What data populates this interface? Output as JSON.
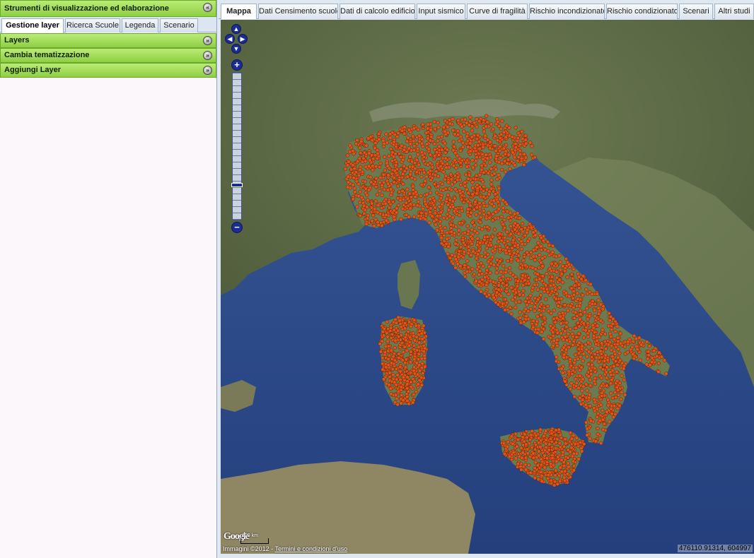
{
  "left_panel": {
    "title": "Strumenti di visualizzazione ed elaborazione",
    "tabs": [
      "Gestione layer",
      "Ricerca Scuole",
      "Legenda",
      "Scenario"
    ],
    "active_tab": "Gestione layer",
    "sections": [
      "Layers",
      "Cambia tematizzazione",
      "Aggiungi Layer"
    ]
  },
  "map_tabs": {
    "items": [
      "Mappa",
      "Dati Censimento scuole",
      "Dati di calcolo edificio",
      "Input sismico",
      "Curve di fragilità",
      "Rischio incondizionato",
      "Rischio condizionato",
      "Scenari",
      "Altri studi"
    ],
    "active": "Mappa"
  },
  "map": {
    "attribution_prefix": "Immagini ©2012",
    "attribution_sep": " - ",
    "attribution_link": "Termini e condizioni d'uso",
    "google_logo": "Google",
    "scale_label": "100 km",
    "coordinates": "476110.91314, 604997",
    "zoom_in": "+",
    "zoom_out": "−",
    "point_color": "#e0561a",
    "sea_color": "#2f4f8f",
    "land_color": "#5f6e4a"
  }
}
